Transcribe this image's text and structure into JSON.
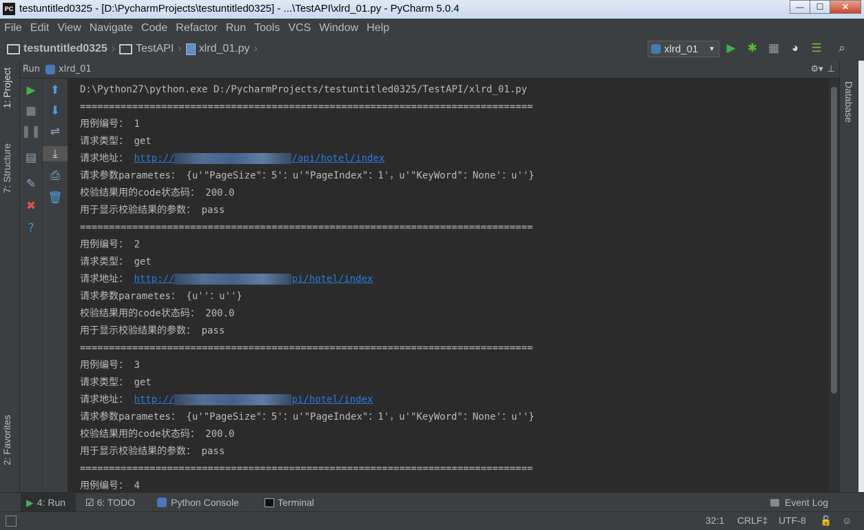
{
  "window": {
    "title": "testuntitled0325 - [D:\\PycharmProjects\\testuntitled0325] - ...\\TestAPI\\xlrd_01.py - PyCharm 5.0.4",
    "app_icon": "PC"
  },
  "menu": [
    "File",
    "Edit",
    "View",
    "Navigate",
    "Code",
    "Refactor",
    "Run",
    "Tools",
    "VCS",
    "Window",
    "Help"
  ],
  "breadcrumb": {
    "project": "testuntitled0325",
    "folder": "TestAPI",
    "file": "xlrd_01.py"
  },
  "run_config": {
    "selected": "xlrd_01"
  },
  "left_tabs": {
    "project": "1: Project",
    "structure": "7: Structure",
    "favorites": "2: Favorites"
  },
  "right_tabs": {
    "database": "Database"
  },
  "run_panel": {
    "label": "Run",
    "config": "xlrd_01"
  },
  "console": {
    "command": "D:\\Python27\\python.exe D:/PycharmProjects/testuntitled0325/TestAPI/xlrd_01.py",
    "separator": "==============================================================================",
    "labels": {
      "case_no": "用例编号：",
      "req_type": "请求类型：",
      "req_url": "请求地址：",
      "params": "请求参数parametes：",
      "code": "校验结果用的code状态码：",
      "result": "用于显示校验结果的参数："
    },
    "cases": [
      {
        "no": "1",
        "type": "get",
        "url_start": "http://",
        "url_end": "/api/hotel/index",
        "params": "{u'\"PageSize\"：5'：u'\"PageIndex\"：1'，u'\"KeyWord\"：None'：u''}",
        "code": "200.0",
        "result": "pass"
      },
      {
        "no": "2",
        "type": "get",
        "url_start": "http://",
        "url_end": "pi/hotel/index",
        "params": "{u''：u''}",
        "code": "200.0",
        "result": "pass"
      },
      {
        "no": "3",
        "type": "get",
        "url_start": "http://",
        "url_end": "pi/hotel/index",
        "params": "{u'\"PageSize\"：5'：u'\"PageIndex\"：1'，u'\"KeyWord\"：None'：u''}",
        "code": "200.0",
        "result": "pass"
      }
    ],
    "case4_no": "4"
  },
  "bottom_tabs": {
    "run": "4: Run",
    "todo": "6: TODO",
    "python_console": "Python Console",
    "terminal": "Terminal",
    "event_log": "Event Log"
  },
  "status": {
    "position": "32:1",
    "line_sep": "CRLF‡",
    "encoding": "UTF-8"
  }
}
